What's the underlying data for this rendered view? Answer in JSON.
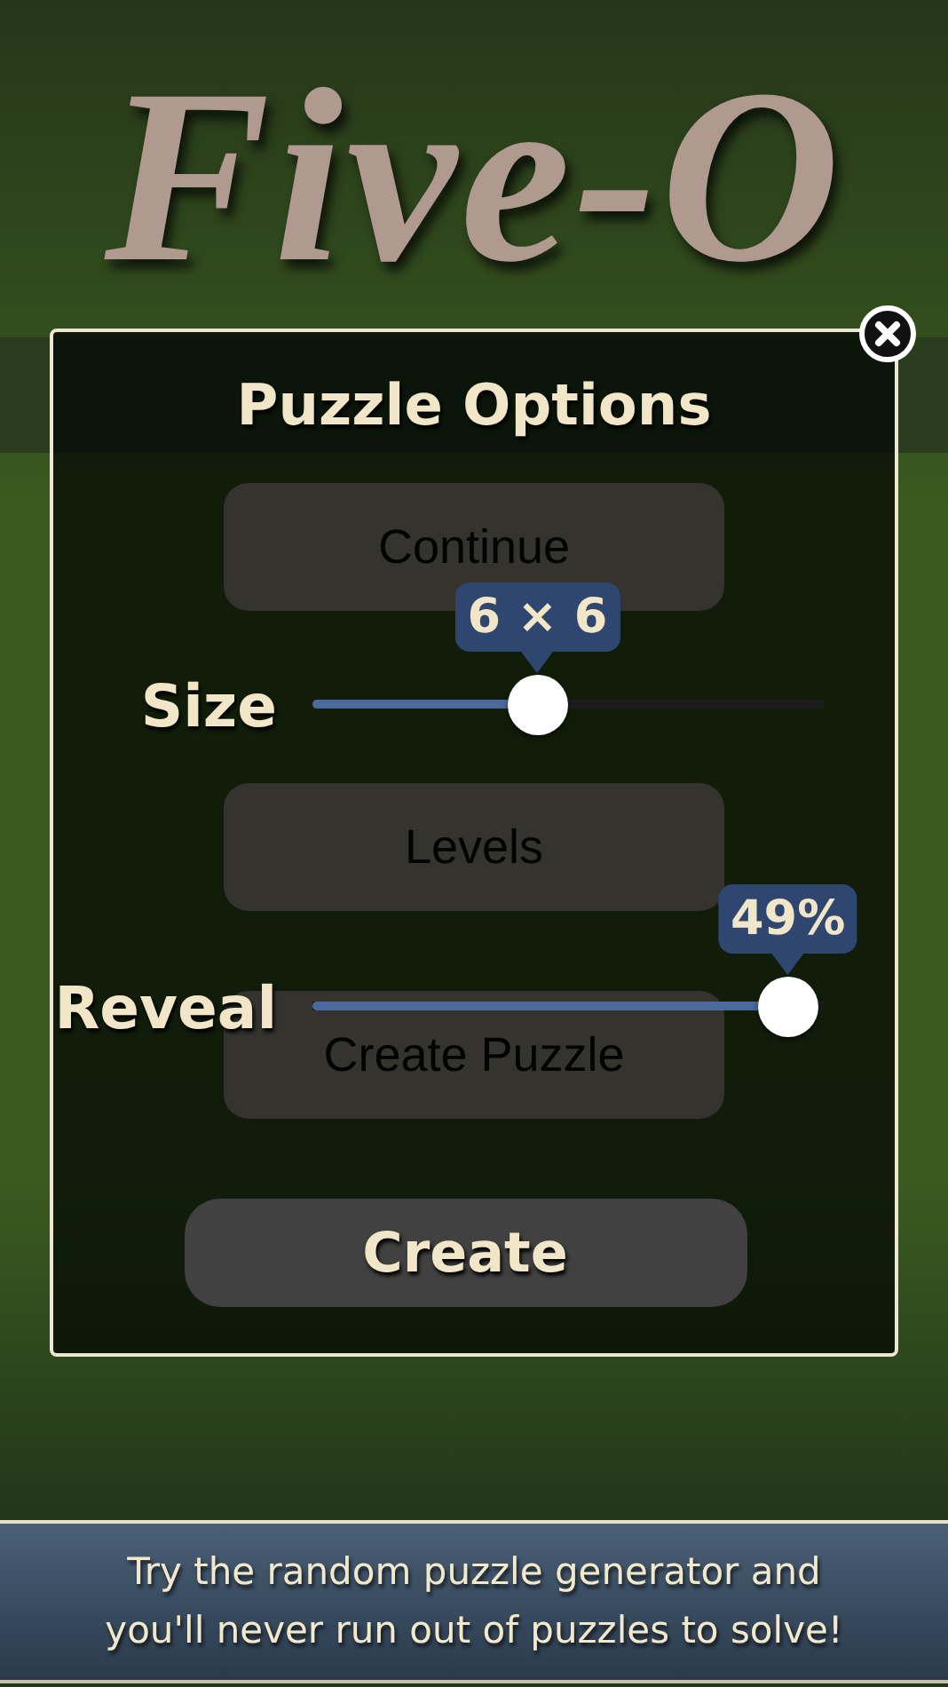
{
  "background": {
    "title": "Five-O",
    "menu": [
      {
        "label": "Continue"
      },
      {
        "label": "Levels"
      },
      {
        "label": "Create Puzzle"
      }
    ]
  },
  "dialog": {
    "title": "Puzzle Options",
    "sliders": [
      {
        "label": "Size",
        "level": 0.44,
        "reading": "6 × 6"
      },
      {
        "label": "Reveal",
        "level": 0.93,
        "reading": "49%"
      }
    ],
    "button": "Create"
  },
  "banner": {
    "text": "Try the random puzzle generator and you'll never run out of puzzles to solve!"
  }
}
